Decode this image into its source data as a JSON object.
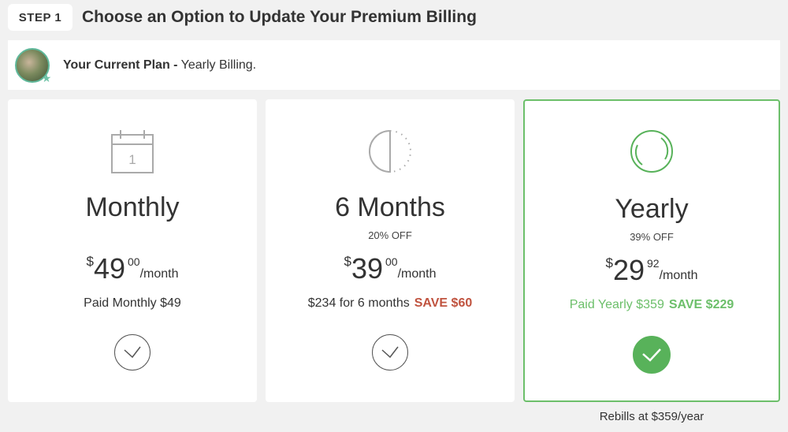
{
  "header": {
    "step_label": "STEP 1",
    "title": "Choose an Option to Update Your Premium Billing"
  },
  "current_plan": {
    "label": "Your Current Plan -",
    "value": "Yearly Billing."
  },
  "plans": [
    {
      "name": "Monthly",
      "icon": "calendar-icon",
      "icon_text": "1",
      "discount": "",
      "price_dollar": "$",
      "price_int": "49",
      "price_cents": "00",
      "price_per": "/month",
      "paid_text": "Paid Monthly $49",
      "save_text": "",
      "selected": false
    },
    {
      "name": "6 Months",
      "icon": "half-circle-icon",
      "discount": "20% OFF",
      "price_dollar": "$",
      "price_int": "39",
      "price_cents": "00",
      "price_per": "/month",
      "paid_text": "$234 for 6 months",
      "save_text": "SAVE $60",
      "selected": false
    },
    {
      "name": "Yearly",
      "icon": "full-circle-icon",
      "discount": "39% OFF",
      "price_dollar": "$",
      "price_int": "29",
      "price_cents": "92",
      "price_per": "/month",
      "paid_text": "Paid Yearly $359",
      "save_text": "SAVE $229",
      "selected": true
    }
  ],
  "rebills_note": "Rebills at $359/year",
  "colors": {
    "accent_green": "#6cbf6a",
    "check_green": "#58b25a",
    "save_red": "#c0533f",
    "background": "#f1f1f1"
  }
}
